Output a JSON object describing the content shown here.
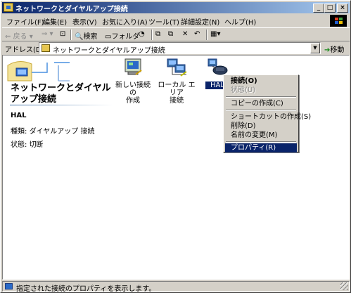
{
  "window": {
    "title": "ネットワークとダイヤルアップ接続",
    "min": "_",
    "max": "□",
    "close": "×"
  },
  "menubar": [
    "ファイル(F)",
    "編集(E)",
    "表示(V)",
    "お気に入り(A)",
    "ツール(T)",
    "詳細設定(N)",
    "ヘルプ(H)"
  ],
  "toolbar": {
    "back": "戻る",
    "search": "検索",
    "folders": "フォルダ"
  },
  "address": {
    "label": "アドレス(D)",
    "value": "ネットワークとダイヤルアップ接続",
    "go": "移動"
  },
  "panel": {
    "title": "ネットワークとダイヤルアップ接続",
    "selected_name": "HAL",
    "type_label": "種類",
    "type_value": "ダイヤルアップ 接続",
    "status_label": "状態",
    "status_value": "切断"
  },
  "items": [
    {
      "label": "新しい接続の\n作成"
    },
    {
      "label": "ローカル エリア\n接続"
    },
    {
      "label": "HAL"
    }
  ],
  "context_menu": [
    "接続(O)",
    "状態(U)",
    "コピーの作成(C)",
    "ショートカットの作成(S)",
    "削除(D)",
    "名前の変更(M)",
    "プロパティ(R)"
  ],
  "statusbar": {
    "text": "指定された接続のプロパティを表示します。"
  },
  "colors": {
    "title_start": "#0a246a",
    "title_end": "#a6caf0",
    "highlight": "#0a246a",
    "face": "#d4d0c8"
  }
}
